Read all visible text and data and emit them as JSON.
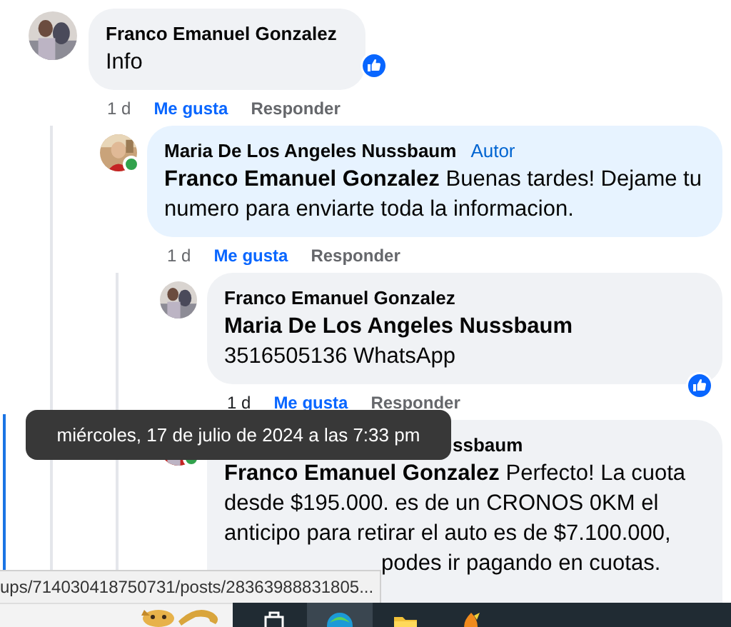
{
  "comments": [
    {
      "author": "Franco Emanuel Gonzalez",
      "text": "Info",
      "reaction": true,
      "actions": {
        "time": "1 d",
        "time_hovered": false,
        "like": "Me gusta",
        "reply": "Responder"
      },
      "replies": [
        {
          "author": "Maria De Los Angeles Nussbaum",
          "badge": "Autor",
          "online": true,
          "text": "**Franco Emanuel Gonzalez** Buenas tardes! Dejame tu numero para enviarte toda la informacion.",
          "actions": {
            "time": "1 d",
            "time_hovered": false,
            "like": "Me gusta",
            "reply": "Responder"
          },
          "replies": [
            {
              "author": "Franco Emanuel Gonzalez",
              "text": "**Maria De Los Angeles Nussbaum**\n3516505136 WhatsApp",
              "reaction": true,
              "actions": {
                "time": "1 d",
                "time_hovered": true,
                "like": "Me gusta",
                "reply": "Responder"
              }
            },
            {
              "author": "ssbaum",
              "author_covered": true,
              "online": true,
              "text": "**Franco Emanuel Gonzalez** Perfecto! La cuota desde $195.000. es de un CRONOS 0KM el anticipo para retirar el auto es de $7.100.000,",
              "text_continued": "podes ir pagando en cuotas."
            }
          ]
        }
      ]
    }
  ],
  "tooltip": {
    "text": "miércoles, 17 de julio de 2024 a las 7:33 pm"
  },
  "status_bar": {
    "url": "ups/714030418750731/posts/28363988831805..."
  },
  "taskbar": {
    "apps": [
      {
        "kind": "taskview",
        "selected": false
      },
      {
        "kind": "browser",
        "selected": true
      },
      {
        "kind": "folder",
        "selected": false
      },
      {
        "kind": "flame",
        "selected": false
      }
    ]
  }
}
